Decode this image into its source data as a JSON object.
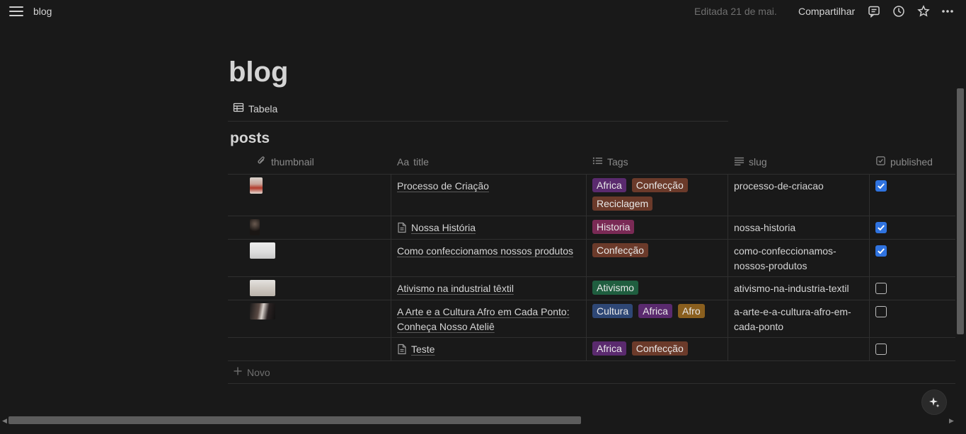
{
  "topbar": {
    "breadcrumb": "blog",
    "edited": "Editada 21 de mai.",
    "share": "Compartilhar"
  },
  "page": {
    "title": "blog",
    "view_tab": "Tabela",
    "db_title": "posts"
  },
  "table": {
    "headers": {
      "thumbnail": "thumbnail",
      "title": "title",
      "title_prefix": "Aa",
      "tags": "Tags",
      "slug": "slug",
      "published": "published"
    },
    "rows": [
      {
        "title_lines": [
          "Processo de Criação",
          ""
        ],
        "has_doc_icon": false,
        "tags": [
          "Africa",
          "Confecção",
          "Reciclagem"
        ],
        "slug_lines": [
          "processo-de-criacao",
          ""
        ],
        "published": true
      },
      {
        "title_lines": [
          "Nossa História",
          ""
        ],
        "has_doc_icon": true,
        "tags": [
          "Historia"
        ],
        "slug_lines": [
          "nossa-historia",
          ""
        ],
        "published": true
      },
      {
        "title_lines": [
          "Como confeccionamos nossos produtos",
          ""
        ],
        "has_doc_icon": false,
        "tags": [
          "Confecção"
        ],
        "slug_lines": [
          "como-confeccionamos-",
          "nossos-produtos"
        ],
        "published": true
      },
      {
        "title_lines": [
          "Ativismo na industrial têxtil",
          ""
        ],
        "has_doc_icon": false,
        "tags": [
          "Ativismo"
        ],
        "slug_lines": [
          "ativismo-na-industria-textil",
          ""
        ],
        "published": false
      },
      {
        "title_lines": [
          "A Arte e a Cultura Afro em Cada Ponto:",
          "Conheça Nosso Ateliê"
        ],
        "has_doc_icon": false,
        "tags": [
          "Cultura",
          "Africa",
          "Afro"
        ],
        "slug_lines": [
          "a-arte-e-a-cultura-afro-em-",
          "cada-ponto"
        ],
        "published": false
      },
      {
        "title_lines": [
          "Teste",
          ""
        ],
        "has_doc_icon": true,
        "tags": [
          "Africa",
          "Confecção"
        ],
        "slug_lines": [
          "",
          ""
        ],
        "published": false
      }
    ],
    "new_label": "Novo"
  },
  "tag_colors": {
    "Africa": "#5a2a6e",
    "Confecção": "#6b3a2a",
    "Reciclagem": "#6b3a2a",
    "Historia": "#7a2a55",
    "Ativismo": "#1f5e3f",
    "Cultura": "#2e4775",
    "Afro": "#8a5f1e"
  },
  "colors": {
    "background": "#191919",
    "checkbox_on": "#2f73e0"
  },
  "icons": [
    "menu-icon",
    "comment-icon",
    "history-icon",
    "star-icon",
    "more-icon",
    "table-view-icon",
    "attachment-icon",
    "list-icon",
    "text-icon",
    "checkbox-icon",
    "document-icon",
    "plus-icon",
    "sparkle-icon"
  ]
}
